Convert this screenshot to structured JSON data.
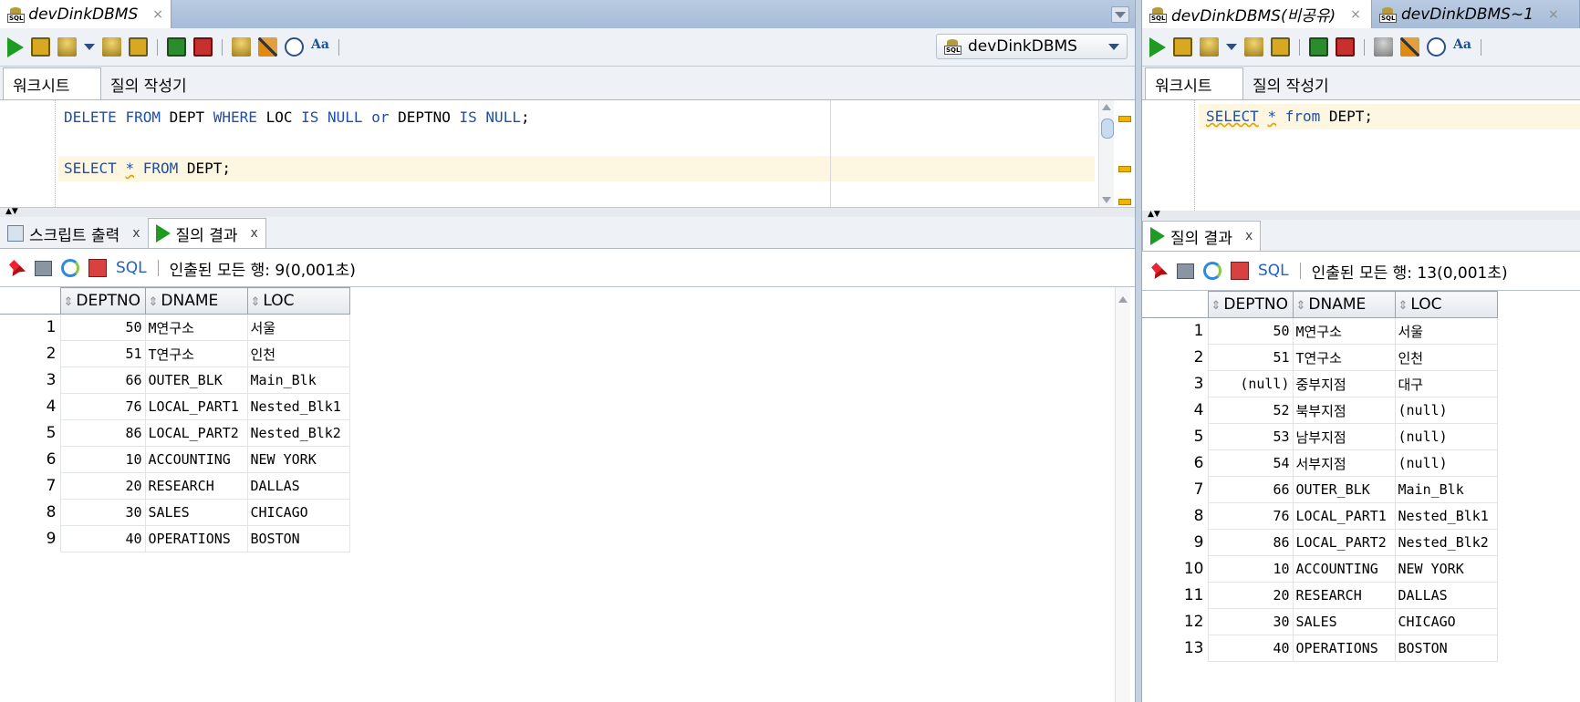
{
  "left": {
    "doc_tab": "devDinkDBMS",
    "close_glyph": "×",
    "connection": "devDinkDBMS",
    "subtabs": [
      "워크시트",
      "질의 작성기"
    ],
    "code_lines": [
      [
        {
          "t": "DELETE",
          "kw": true
        },
        {
          "t": " "
        },
        {
          "t": "FROM",
          "kw": true
        },
        {
          "t": " DEPT "
        },
        {
          "t": "WHERE",
          "kw": true
        },
        {
          "t": " LOC "
        },
        {
          "t": "IS",
          "kw": true
        },
        {
          "t": " "
        },
        {
          "t": "NULL",
          "kw": true
        },
        {
          "t": " "
        },
        {
          "t": "or",
          "kw": true
        },
        {
          "t": " DEPTNO "
        },
        {
          "t": "IS",
          "kw": true
        },
        {
          "t": " "
        },
        {
          "t": "NULL",
          "kw": true
        },
        {
          "t": ";"
        }
      ],
      [],
      [
        {
          "t": "SELECT",
          "kw": true
        },
        {
          "t": " "
        },
        {
          "t": "*",
          "kw": true,
          "squig": true
        },
        {
          "t": " "
        },
        {
          "t": "FROM",
          "kw": true
        },
        {
          "t": " DEPT;"
        }
      ]
    ],
    "result_tabs": [
      {
        "label": "스크립트 출력",
        "icon": "script-output-icon",
        "close": "x"
      },
      {
        "label": "질의 결과",
        "icon": "run-icon",
        "close": "x"
      }
    ],
    "sql_label": "SQL",
    "fetch_status": "인출된 모든 행: 9(0,001초)",
    "columns": [
      "DEPTNO",
      "DNAME",
      "LOC"
    ],
    "rows": [
      [
        "1",
        "50",
        "M연구소",
        "서울"
      ],
      [
        "2",
        "51",
        "T연구소",
        "인천"
      ],
      [
        "3",
        "66",
        "OUTER_BLK",
        "Main_Blk"
      ],
      [
        "4",
        "76",
        "LOCAL_PART1",
        "Nested_Blk1"
      ],
      [
        "5",
        "86",
        "LOCAL_PART2",
        "Nested_Blk2"
      ],
      [
        "6",
        "10",
        "ACCOUNTING",
        "NEW YORK"
      ],
      [
        "7",
        "20",
        "RESEARCH",
        "DALLAS"
      ],
      [
        "8",
        "30",
        "SALES",
        "CHICAGO"
      ],
      [
        "9",
        "40",
        "OPERATIONS",
        "BOSTON"
      ]
    ]
  },
  "right": {
    "doc_tabs": [
      "devDinkDBMS(비공유)",
      "devDinkDBMS~1"
    ],
    "close_glyph": "×",
    "subtabs": [
      "워크시트",
      "질의 작성기"
    ],
    "code_lines": [
      [
        {
          "t": "SELECT",
          "kw": true,
          "squig": true
        },
        {
          "t": " "
        },
        {
          "t": "*",
          "kw": true,
          "squig": true
        },
        {
          "t": " "
        },
        {
          "t": "from",
          "kw": true
        },
        {
          "t": " DEPT;"
        }
      ]
    ],
    "result_tabs": [
      {
        "label": "질의 결과",
        "icon": "run-icon",
        "close": "x"
      }
    ],
    "sql_label": "SQL",
    "fetch_status": "인출된 모든 행: 13(0,001초)",
    "columns": [
      "DEPTNO",
      "DNAME",
      "LOC"
    ],
    "rows": [
      [
        "1",
        "50",
        "M연구소",
        "서울"
      ],
      [
        "2",
        "51",
        "T연구소",
        "인천"
      ],
      [
        "3",
        "(null)",
        "중부지점",
        "대구"
      ],
      [
        "4",
        "52",
        "북부지점",
        "(null)"
      ],
      [
        "5",
        "53",
        "남부지점",
        "(null)"
      ],
      [
        "6",
        "54",
        "서부지점",
        "(null)"
      ],
      [
        "7",
        "66",
        "OUTER_BLK",
        "Main_Blk"
      ],
      [
        "8",
        "76",
        "LOCAL_PART1",
        "Nested_Blk1"
      ],
      [
        "9",
        "86",
        "LOCAL_PART2",
        "Nested_Blk2"
      ],
      [
        "10",
        "10",
        "ACCOUNTING",
        "NEW YORK"
      ],
      [
        "11",
        "20",
        "RESEARCH",
        "DALLAS"
      ],
      [
        "12",
        "30",
        "SALES",
        "CHICAGO"
      ],
      [
        "13",
        "40",
        "OPERATIONS",
        "BOSTON"
      ]
    ]
  },
  "colors": {
    "keyword": "#1f4fa8",
    "run_green": "#1f9b24",
    "current_line": "#fdf7e2",
    "tab_strip": "#b9cbe2"
  }
}
